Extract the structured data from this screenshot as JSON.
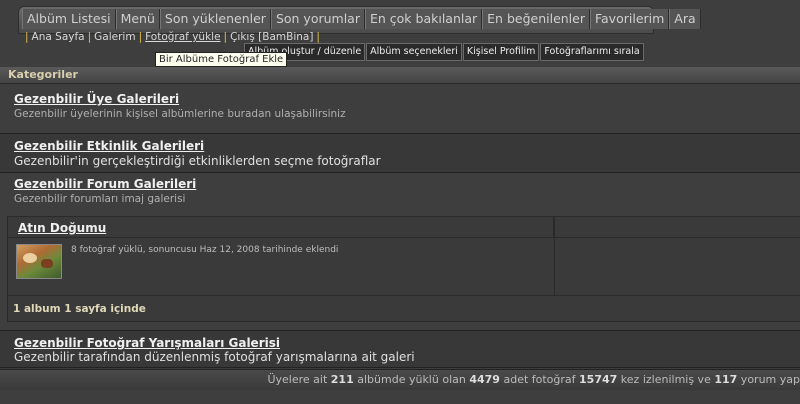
{
  "nav": {
    "tabs": [
      "Albüm Listesi",
      "Menü",
      "Son yüklenenler",
      "Son yorumlar",
      "En çok bakılanlar",
      "En beğenilenler",
      "Favorilerim",
      "Ara"
    ]
  },
  "subnav": {
    "home": "Ana Sayfa",
    "gallery": "Galerim",
    "upload": "Fotoğraf yükle",
    "logout": "Çıkış [BamBina]"
  },
  "tooltip": "Bir Albüme Fotoğraf Ekle",
  "subtabs": [
    "Albüm oluştur / düzenle",
    "Albüm seçenekleri",
    "Kişisel Profilim",
    "Fotoğraflarımı sırala"
  ],
  "categories_header": "Kategoriler",
  "categories": [
    {
      "title": "Gezenbilir Üye Galerileri",
      "desc": "Gezenbilir üyelerinin kişisel albümlerine buradan ulaşabilirsiniz"
    },
    {
      "title": "Gezenbilir Etkinlik Galerileri",
      "desc": "Gezenbilir'in gerçekleştirdiği etkinliklerden seçme fotoğraflar"
    },
    {
      "title": "Gezenbilir Forum Galerileri",
      "desc": "Gezenbilir forumları imaj galerisi"
    },
    {
      "title": "Gezenbilir Fotoğraf Yarışmaları Galerisi",
      "desc": "Gezenbilir tarafından düzenlenmiş fotoğraf yarışmalarına ait galeri"
    }
  ],
  "album": {
    "title": "Atın Doğumu",
    "meta": "8 fotoğraf yüklü, sonuncusu Haz 12, 2008 tarihinde eklendi",
    "footer": "1 album 1 sayfa içinde"
  },
  "stats": {
    "t1": "Üyelere ait ",
    "albums": "211",
    "t2": " albümde yüklü olan ",
    "photos": "4479",
    "t3": " adet fotoğraf ",
    "views": "15747",
    "t4": " kez izlenilmiş ve ",
    "comments": "117",
    "t5": " yorum yap"
  }
}
